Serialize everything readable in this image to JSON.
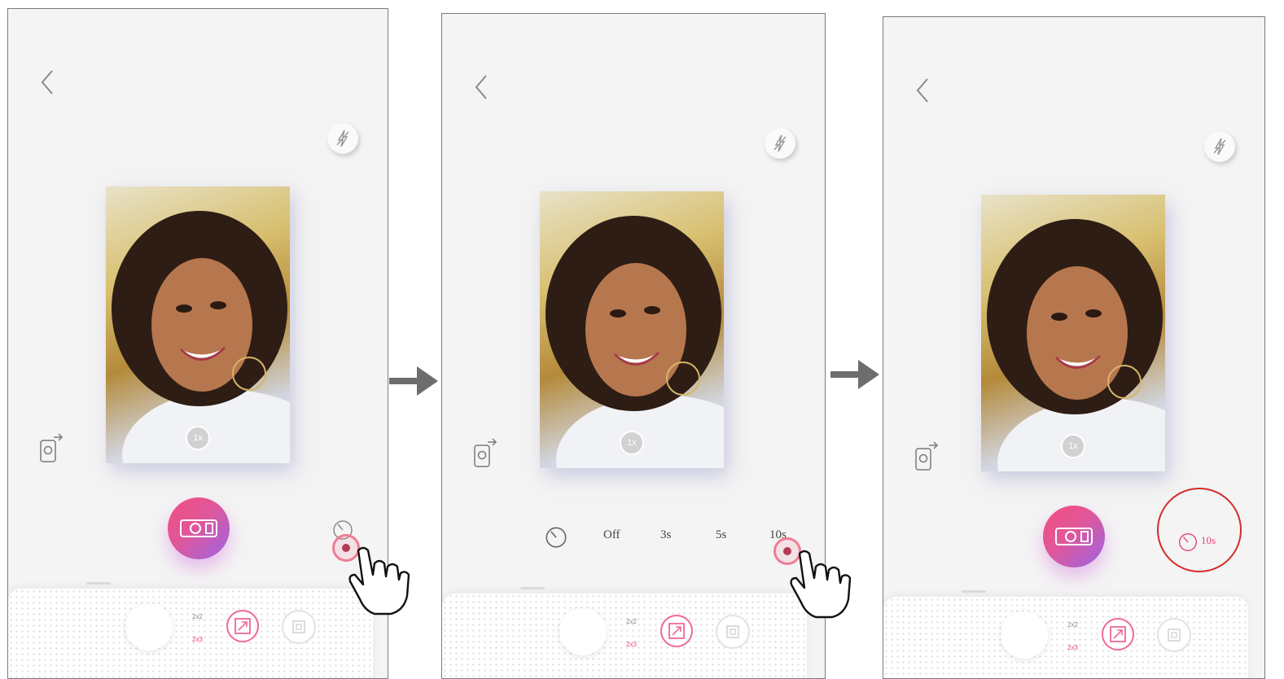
{
  "screens": [
    {
      "zoom_label": "1x",
      "grid_options": [
        "2x2",
        "2x3"
      ]
    },
    {
      "zoom_label": "1x",
      "grid_options": [
        "2x2",
        "2x3"
      ],
      "timer_options": [
        "Off",
        "3s",
        "5s",
        "10s"
      ]
    },
    {
      "zoom_label": "1x",
      "grid_options": [
        "2x2",
        "2x3"
      ],
      "timer_value": "10s"
    }
  ],
  "icons": {
    "back": "chevron-left-icon",
    "flash": "flash-off-icon",
    "flip": "flip-camera-icon",
    "shutter": "camera-icon",
    "timer": "timer-icon",
    "grid": "collage-grid-icon",
    "gallery": "gallery-icon",
    "tap": "hand-pointer-icon",
    "flow": "arrow-right-icon"
  },
  "colors": {
    "accent": "#e5457a",
    "highlight": "#d42b2b",
    "shutter_from": "#f24d7e",
    "shutter_to": "#9a64e6",
    "arrow": "#6d6d6d"
  }
}
